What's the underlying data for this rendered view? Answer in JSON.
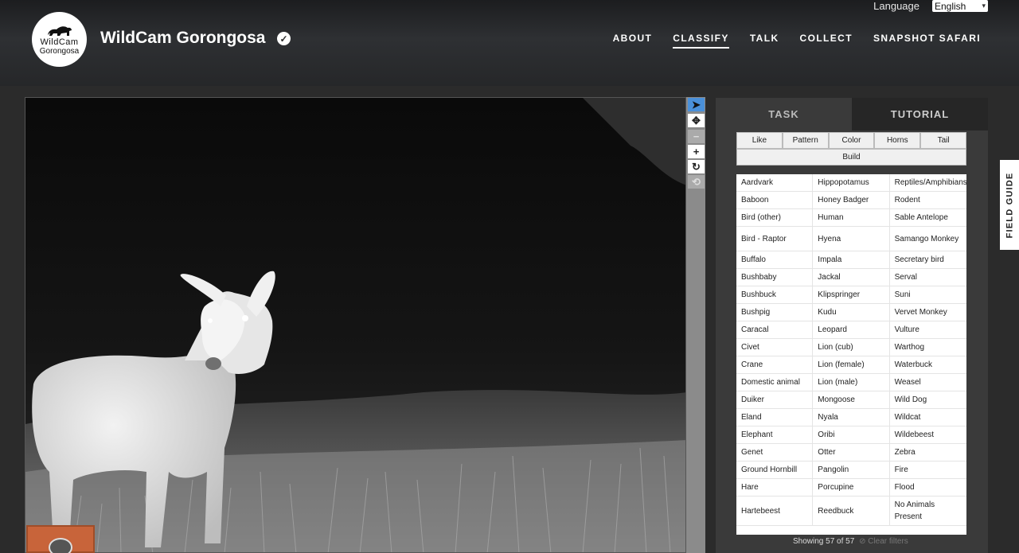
{
  "language": {
    "label": "Language",
    "selected": "English"
  },
  "logo": {
    "line1": "WildCam",
    "line2": "Gorongosa"
  },
  "title": "WildCam Gorongosa",
  "nav": [
    "ABOUT",
    "CLASSIFY",
    "TALK",
    "COLLECT",
    "SNAPSHOT SAFARI"
  ],
  "nav_active": "CLASSIFY",
  "tabs": {
    "task": "TASK",
    "tutorial": "TUTORIAL"
  },
  "filters": [
    "Like",
    "Pattern",
    "Color",
    "Horns",
    "Tail"
  ],
  "filter_build": "Build",
  "species_rows": [
    [
      "Aardvark",
      "Hippopotamus",
      "Reptiles/Amphibians"
    ],
    [
      "Baboon",
      "Honey Badger",
      "Rodent"
    ],
    [
      "Bird (other)",
      "Human",
      "Sable Antelope"
    ],
    [
      "Bird - Raptor",
      "Hyena",
      "Samango Monkey"
    ],
    [
      "Buffalo",
      "Impala",
      "Secretary bird"
    ],
    [
      "Bushbaby",
      "Jackal",
      "Serval"
    ],
    [
      "Bushbuck",
      "Klipspringer",
      "Suni"
    ],
    [
      "Bushpig",
      "Kudu",
      "Vervet Monkey"
    ],
    [
      "Caracal",
      "Leopard",
      "Vulture"
    ],
    [
      "Civet",
      "Lion (cub)",
      "Warthog"
    ],
    [
      "Crane",
      "Lion (female)",
      "Waterbuck"
    ],
    [
      "Domestic animal",
      "Lion (male)",
      "Weasel"
    ],
    [
      "Duiker",
      "Mongoose",
      "Wild Dog"
    ],
    [
      "Eland",
      "Nyala",
      "Wildcat"
    ],
    [
      "Elephant",
      "Oribi",
      "Wildebeest"
    ],
    [
      "Genet",
      "Otter",
      "Zebra"
    ],
    [
      "Ground Hornbill",
      "Pangolin",
      "Fire"
    ],
    [
      "Hare",
      "Porcupine",
      "Flood"
    ],
    [
      "Hartebeest",
      "Reedbuck",
      "No Animals Present"
    ]
  ],
  "showing": "Showing 57 of 57",
  "clear_filters": "⊘ Clear filters",
  "field_guide": "FIELD GUIDE",
  "tools": [
    "pointer-icon",
    "move-icon",
    "zoom-out-icon",
    "zoom-in-icon",
    "rotate-icon",
    "reset-icon"
  ],
  "colors": {
    "accent": "#4a90d9",
    "thumb": "#c8643a"
  }
}
